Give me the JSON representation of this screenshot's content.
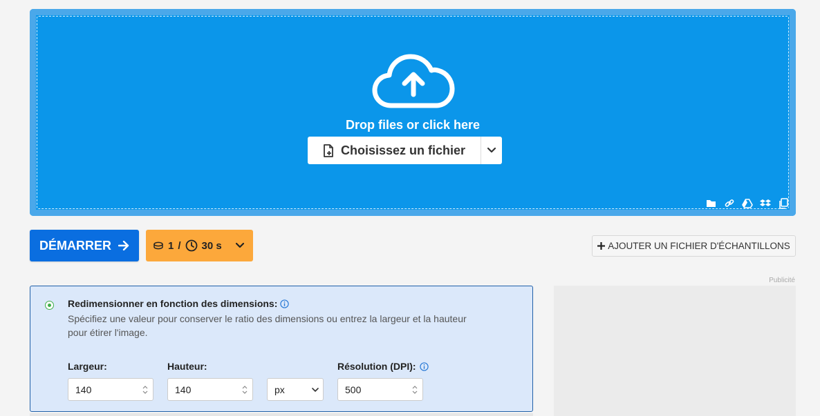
{
  "dropzone": {
    "prompt": "Drop files or click here",
    "choose_label": "Choisissez un fichier",
    "sources": [
      "folder-icon",
      "link-icon",
      "google-drive-icon",
      "dropbox-icon",
      "clipboard-icon"
    ],
    "bg_color": "#0b96ea"
  },
  "toolbar": {
    "start_label": "DÉMARRER",
    "credits_count": "1",
    "credits_sep": "/",
    "time_label": "30 s",
    "sample_label": "AJOUTER UN FICHIER D'ÉCHANTILLONS"
  },
  "ad": {
    "label": "Publicité"
  },
  "options": {
    "title": "Redimensionner en fonction des dimensions:",
    "description": "Spécifiez une valeur pour conserver le ratio des dimensions ou entrez la largeur et la hauteur pour étirer l'image.",
    "width_label": "Largeur:",
    "width_value": "140",
    "height_label": "Hauteur:",
    "height_value": "140",
    "unit_value": "px",
    "resolution_label": "Résolution (DPI):",
    "resolution_value": "500"
  }
}
